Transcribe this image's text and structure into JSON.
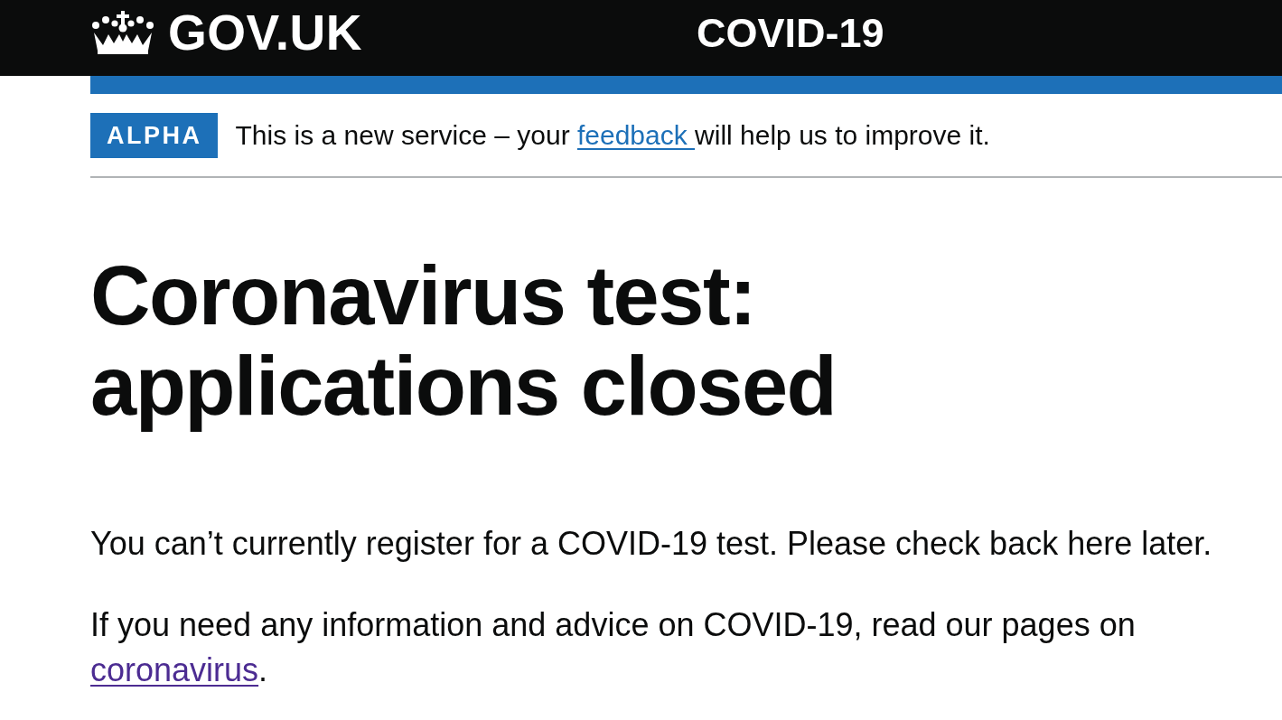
{
  "header": {
    "logo_text": "GOV.UK",
    "service_name": "COVID-19"
  },
  "phase_banner": {
    "tag": "ALPHA",
    "text_before": "This is a new service – your ",
    "link": {
      "text": "feedback ",
      "visited": false
    },
    "text_after": "will help us to improve it."
  },
  "main": {
    "heading": "Coronavirus test: applications closed",
    "paragraphs": [
      {
        "text": "You can’t currently register for a COVID-19 test. Please check back here later."
      },
      {
        "text": "If you need any information and advice on COVID-19, read our pages on ",
        "link": {
          "text": "coronavirus",
          "visited": true
        },
        "text_after": "."
      }
    ]
  }
}
